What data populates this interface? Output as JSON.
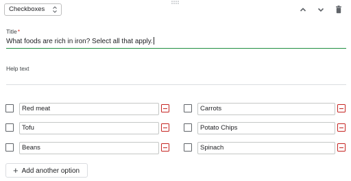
{
  "question": {
    "type_select": {
      "value": "Checkboxes"
    },
    "toolbar": {
      "icons": [
        "chevron-up-icon",
        "chevron-down-icon",
        "trash-icon"
      ],
      "icon_color": "#5f6368"
    },
    "title": {
      "label": "Title",
      "required_marker": "*",
      "value": "What foods are rich in iron? Select all that apply."
    },
    "help_text": {
      "label": "Help text",
      "value": ""
    },
    "options": [
      {
        "label": "Red meat"
      },
      {
        "label": "Carrots"
      },
      {
        "label": "Tofu"
      },
      {
        "label": "Potato Chips"
      },
      {
        "label": "Beans"
      },
      {
        "label": "Spinach"
      }
    ],
    "add_option_label": "Add another option"
  },
  "colors": {
    "accent": "#1e8e3e",
    "required": "#d93025",
    "remove": "#c5221f"
  }
}
